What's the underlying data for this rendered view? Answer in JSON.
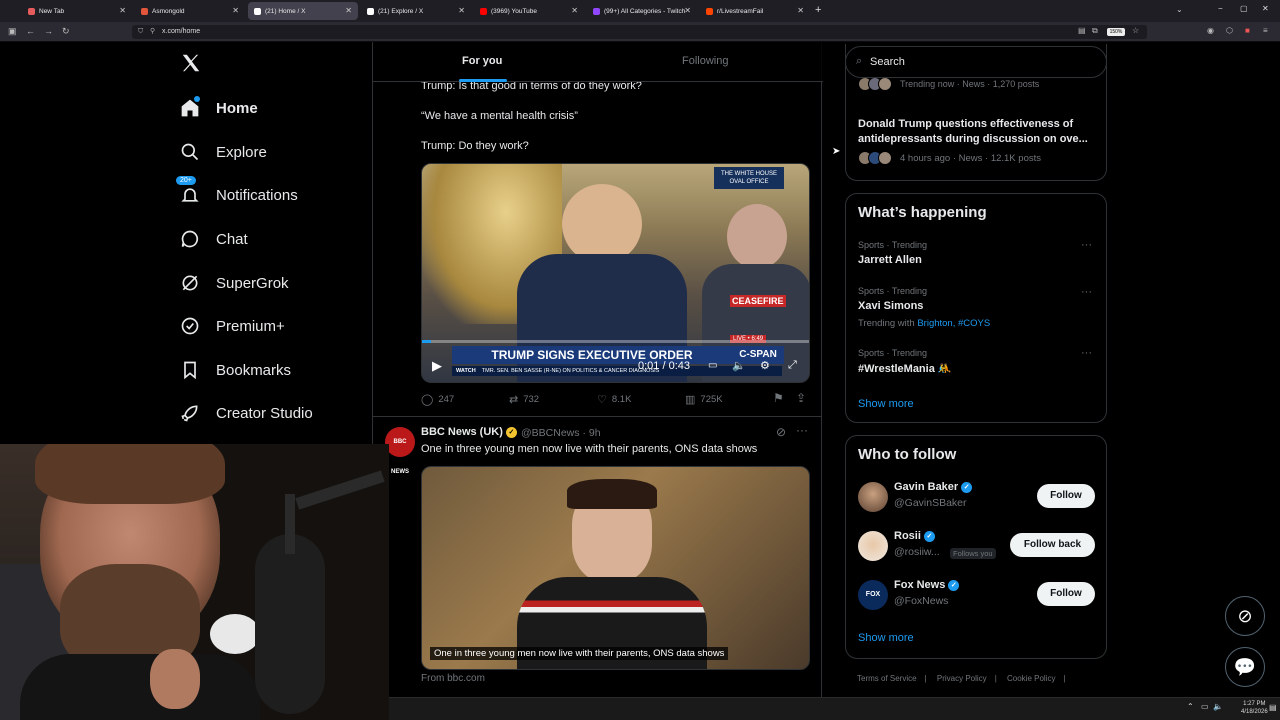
{
  "browser": {
    "tabs": [
      {
        "label": "New Tab",
        "color": "#e65c5c"
      },
      {
        "label": "Asmongold",
        "color": "#e2573b"
      },
      {
        "label": "(21) Home / X",
        "color": "#ffffff"
      },
      {
        "label": "(21) Explore / X",
        "color": "#ffffff"
      },
      {
        "label": "(3969) YouTube",
        "color": "#ff0000"
      },
      {
        "label": "(99+) All Categories - Twitch",
        "color": "#9146ff"
      },
      {
        "label": "r/LivestreamFail",
        "color": "#ff4500"
      }
    ],
    "new_tab_icon": "+",
    "url": "x.com/home",
    "zoom": "150%",
    "window_controls": [
      "−",
      "▢",
      "✕"
    ]
  },
  "sidebar": {
    "logo": "X",
    "items": [
      {
        "label": "Home",
        "icon": "home-icon",
        "glyph": "⌂"
      },
      {
        "label": "Explore",
        "icon": "search-icon",
        "glyph": "⌕"
      },
      {
        "label": "Notifications",
        "icon": "bell-icon",
        "glyph": "🔔",
        "badge": "20+"
      },
      {
        "label": "Chat",
        "icon": "chat-icon",
        "glyph": "◯"
      },
      {
        "label": "SuperGrok",
        "icon": "grok-icon",
        "glyph": "⊘"
      },
      {
        "label": "Premium+",
        "icon": "premium-icon",
        "glyph": "✓"
      },
      {
        "label": "Bookmarks",
        "icon": "bookmark-icon",
        "glyph": "⚑"
      },
      {
        "label": "Creator Studio",
        "icon": "rocket-icon",
        "glyph": "➚"
      }
    ]
  },
  "feed": {
    "tabs": {
      "for_you": "For you",
      "following": "Following"
    },
    "post1": {
      "lines": [
        "Trump: Is that good in terms of do they work?",
        "“We have a mental health crisis”",
        "Trump: Do they work?"
      ],
      "video": {
        "banner": "TRUMP SIGNS EXECUTIVE ORDER",
        "ticker": "TMR. SEN. BEN SASSE (R-NE) ON POLITICS & CANCER DIAGNOSIS",
        "watch": "WATCH",
        "time": "0:01 / 0:43",
        "badge_top": "THE WHITE HOUSE\nOVAL OFFICE",
        "live": "LIVE • 6:49",
        "cspan": "C-SPAN",
        "ceasefire": "CEASEFIRE",
        "progress": 0.023
      },
      "actions": {
        "replies": "247",
        "reposts": "732",
        "likes": "8.1K",
        "views": "725K"
      }
    },
    "post2": {
      "name": "BBC News (UK)",
      "handle": "@BBCNews",
      "time": "· 9h",
      "avatar_text": "BBC NEWS",
      "text": "One in three young men now live with their parents, ONS data shows",
      "image_caption": "One in three young men now live with their parents, ONS data shows",
      "from": "From bbc.com"
    }
  },
  "right": {
    "search_placeholder": "Search",
    "trend_top": {
      "meta": "Trending now · News · 1,270 posts",
      "headline": "Donald Trump questions effectiveness of antidepressants during discussion on ove...",
      "meta2": "4 hours ago · News · 12.1K posts"
    },
    "whats_happening": {
      "title": "What’s happening",
      "items": [
        {
          "meta": "Sports · Trending",
          "name": "Jarrett Allen",
          "extra": ""
        },
        {
          "meta": "Sports · Trending",
          "name": "Xavi Simons",
          "extra": "Trending with"
        },
        {
          "meta": "Sports · Trending",
          "name": "#WrestleMania 🤼",
          "extra": ""
        }
      ],
      "trending_with": [
        "Brighton",
        "#COYS"
      ],
      "show_more": "Show more"
    },
    "who_to_follow": {
      "title": "Who to follow",
      "users": [
        {
          "name": "Gavin Baker",
          "handle": "@GavinSBaker",
          "button": "Follow",
          "follows_you": ""
        },
        {
          "name": "Rosii",
          "handle": "@rosiiw...",
          "button": "Follow back",
          "follows_you": "Follows you"
        },
        {
          "name": "Fox News",
          "handle": "@FoxNews",
          "button": "Follow",
          "follows_you": ""
        }
      ],
      "show_more": "Show more"
    },
    "footer": [
      "Terms of Service",
      "Privacy Policy",
      "Cookie Policy"
    ]
  },
  "taskbar": {
    "time": "1:27 PM",
    "date": "4/18/2026"
  },
  "colors": {
    "accent": "#1d9bf0",
    "border": "#2f3336",
    "muted": "#71767b"
  }
}
